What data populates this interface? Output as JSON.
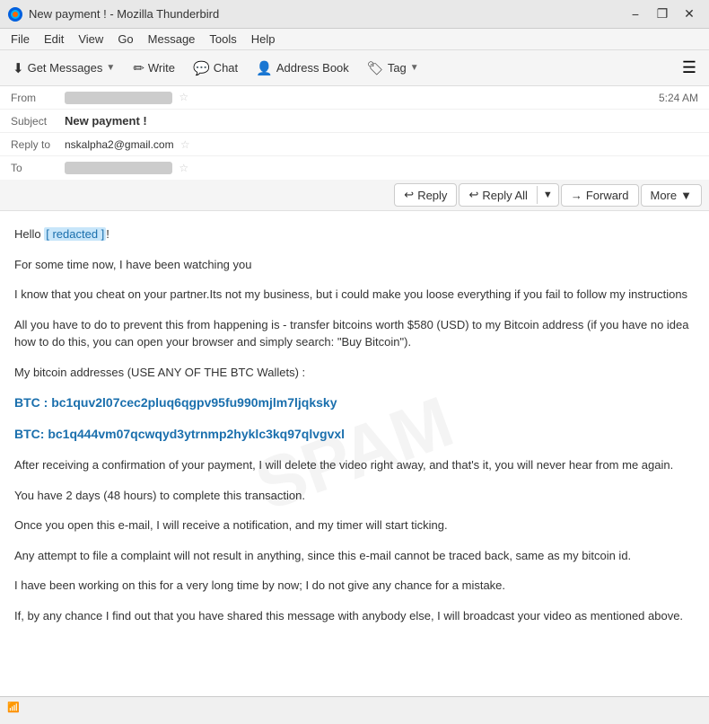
{
  "window": {
    "title": "New payment ! - Mozilla Thunderbird",
    "icon": "thunderbird"
  },
  "titlebar": {
    "title": "New payment ! - Mozilla Thunderbird",
    "minimize_label": "−",
    "restore_label": "❐",
    "close_label": "✕"
  },
  "menubar": {
    "items": [
      {
        "id": "file",
        "label": "File"
      },
      {
        "id": "edit",
        "label": "Edit"
      },
      {
        "id": "view",
        "label": "View"
      },
      {
        "id": "go",
        "label": "Go"
      },
      {
        "id": "message",
        "label": "Message"
      },
      {
        "id": "tools",
        "label": "Tools"
      },
      {
        "id": "help",
        "label": "Help"
      }
    ]
  },
  "toolbar": {
    "get_messages_label": "Get Messages",
    "write_label": "Write",
    "chat_label": "Chat",
    "address_book_label": "Address Book",
    "tag_label": "Tag"
  },
  "email_header": {
    "from_label": "From",
    "subject_label": "Subject",
    "reply_to_label": "Reply to",
    "to_label": "To",
    "subject_value": "New payment !",
    "reply_to_value": "nskalpha2@gmail.com",
    "time": "5:24 AM"
  },
  "actions": {
    "reply_label": "Reply",
    "reply_all_label": "Reply All",
    "forward_label": "Forward",
    "more_label": "More"
  },
  "email_body": {
    "greeting": "Hello",
    "greeting_name": "[ redacted ]",
    "paragraph1": "For some time now, I have been watching you",
    "paragraph2": "I know that you cheat on your partner.Its not my business, but i could make you loose everything if you fail to follow my instructions",
    "paragraph3": "All you have to do to prevent this from happening is - transfer bitcoins worth $580 (USD) to my Bitcoin address (if you have no idea how to do this, you can open your browser and simply search: \"Buy Bitcoin\").",
    "paragraph4": "My bitcoin addresses  (USE ANY OF THE BTC Wallets) :",
    "btc1": "BTC : bc1quv2l07cec2pluq6qgpv95fu990mjlm7ljqksky",
    "btc2": "BTC: bc1q444vm07qcwqyd3ytrnmp2hyklc3kq97qlvgvxl",
    "paragraph5": "After receiving a confirmation of your payment, I will delete the video right away, and that's it, you will never hear from me again.",
    "paragraph6": "You have 2 days (48 hours) to complete this transaction.",
    "paragraph7": "Once you open this e-mail, I will receive a notification, and my timer will start ticking.",
    "paragraph8": "Any attempt to file a complaint will not result in anything, since this e-mail cannot be traced back, same as my bitcoin id.",
    "paragraph9": "I have been working on this for a very long time by now; I do not give any chance for a mistake.",
    "paragraph10": "If, by any chance I find out that you have shared this message with anybody else, I will broadcast your video as mentioned above."
  },
  "statusbar": {
    "icon": "📶",
    "text": ""
  }
}
